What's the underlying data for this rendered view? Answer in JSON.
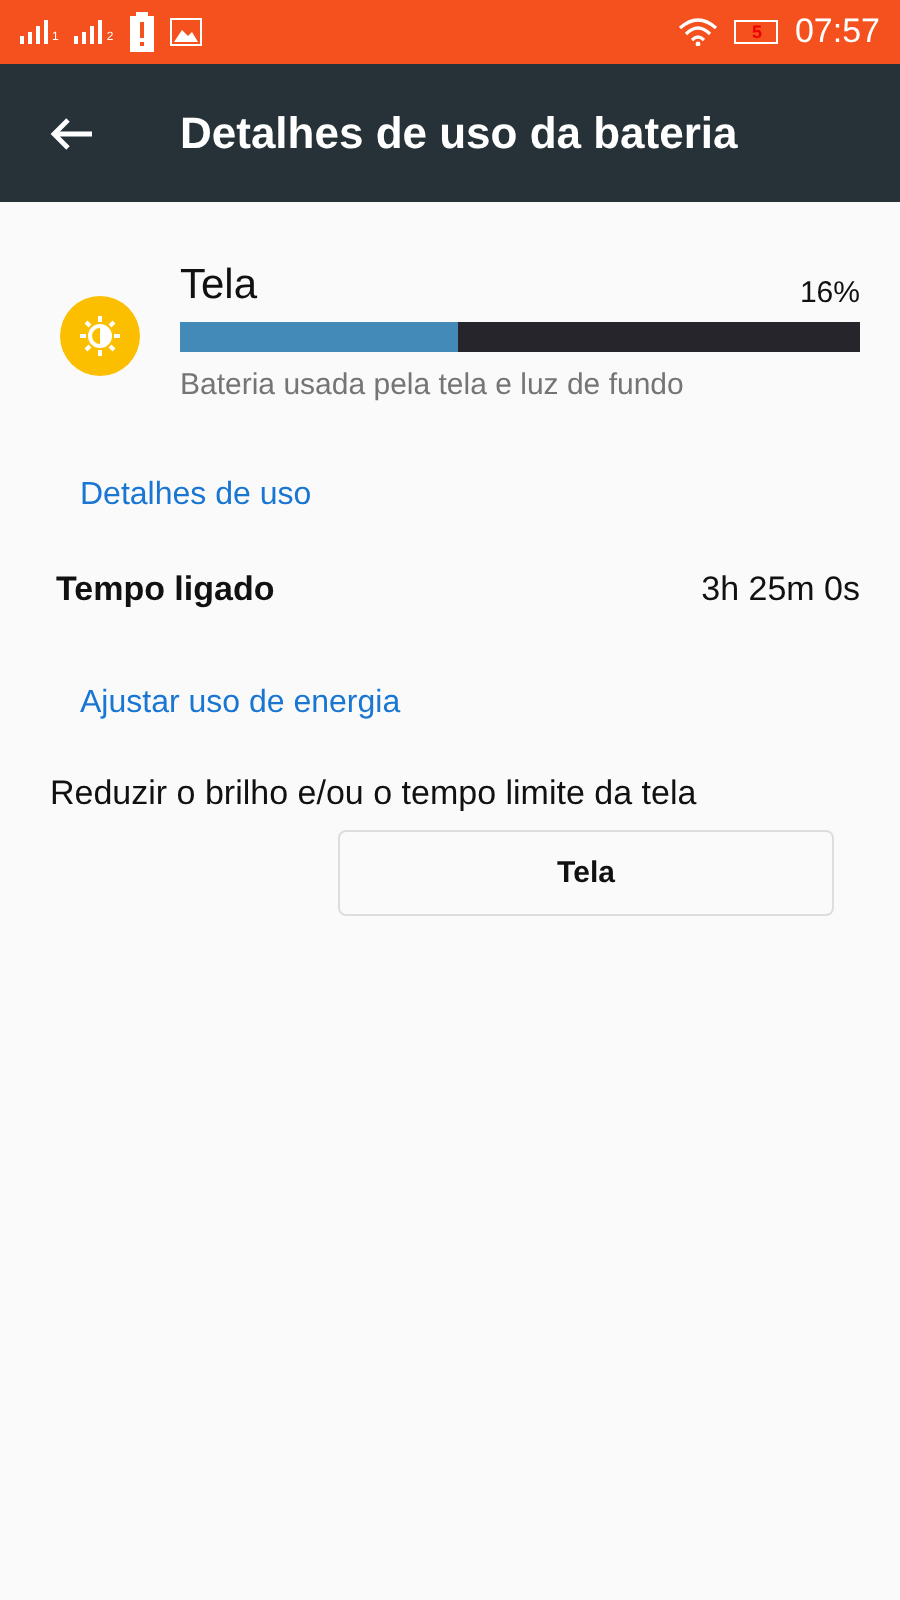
{
  "status_bar": {
    "sims": [
      "1",
      "2"
    ],
    "battery": "5",
    "time": "07:57"
  },
  "app_bar": {
    "title": "Detalhes de uso da bateria"
  },
  "usage": {
    "name": "Tela",
    "percent": "16%",
    "level": 0.41,
    "description": "Bateria usada pela tela e luz de fundo"
  },
  "sections": [
    {
      "header": "Detalhes de uso",
      "rows": [
        {
          "kind": "stat",
          "label": "Tempo ligado",
          "value": "3h 25m 0s"
        }
      ]
    },
    {
      "header": "Ajustar uso de energia",
      "rows": [
        {
          "kind": "action",
          "label": "Reduzir o brilho e/ou o tempo limite da tela",
          "button": "Tela"
        }
      ]
    }
  ]
}
